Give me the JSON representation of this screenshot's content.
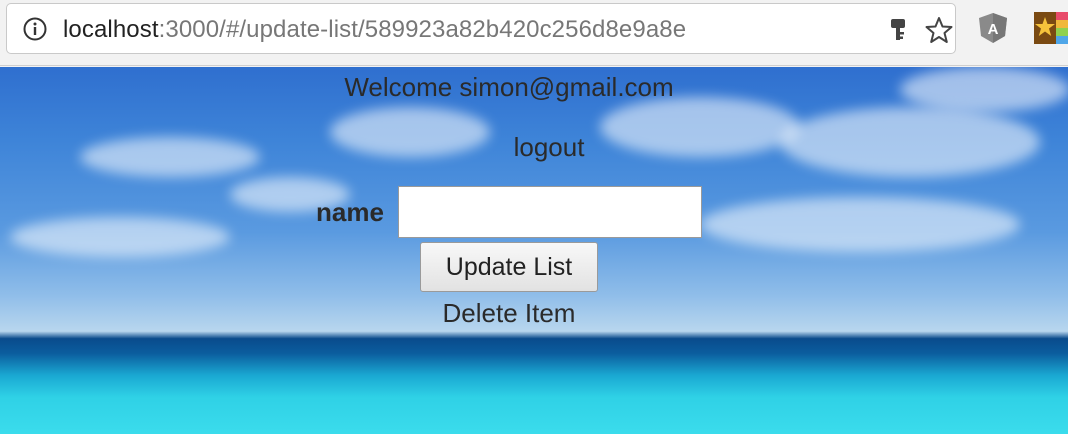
{
  "browser": {
    "url_host": "localhost",
    "url_rest": ":3000/#/update-list/589923a82b420c256d8e9a8e",
    "icons": [
      "info-icon",
      "key-icon",
      "star-icon",
      "angular-extension-icon",
      "bookmark-extension-icon"
    ]
  },
  "page": {
    "welcome_text": "Welcome simon@gmail.com",
    "logout_label": "logout",
    "form": {
      "name_label": "name",
      "name_value": "",
      "name_placeholder": "",
      "submit_label": "Update List"
    },
    "delete_label": "Delete Item"
  }
}
